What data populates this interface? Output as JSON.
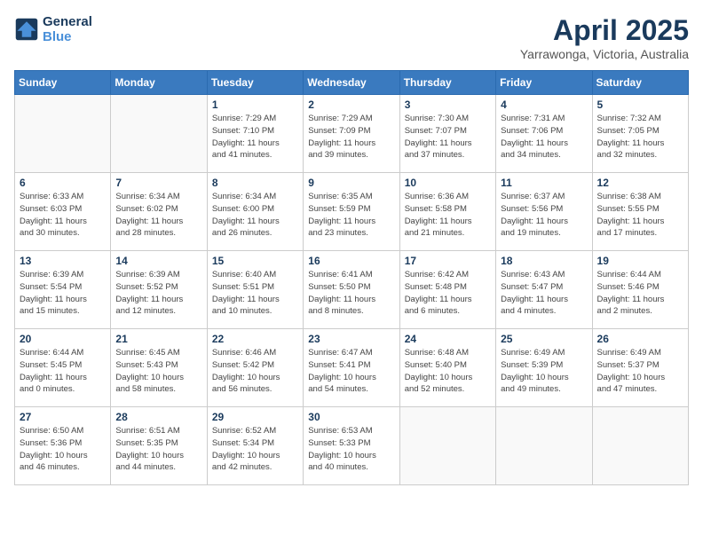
{
  "header": {
    "logo_line1": "General",
    "logo_line2": "Blue",
    "month_title": "April 2025",
    "location": "Yarrawonga, Victoria, Australia"
  },
  "weekdays": [
    "Sunday",
    "Monday",
    "Tuesday",
    "Wednesday",
    "Thursday",
    "Friday",
    "Saturday"
  ],
  "weeks": [
    [
      {
        "day": "",
        "info": ""
      },
      {
        "day": "",
        "info": ""
      },
      {
        "day": "1",
        "info": "Sunrise: 7:29 AM\nSunset: 7:10 PM\nDaylight: 11 hours\nand 41 minutes."
      },
      {
        "day": "2",
        "info": "Sunrise: 7:29 AM\nSunset: 7:09 PM\nDaylight: 11 hours\nand 39 minutes."
      },
      {
        "day": "3",
        "info": "Sunrise: 7:30 AM\nSunset: 7:07 PM\nDaylight: 11 hours\nand 37 minutes."
      },
      {
        "day": "4",
        "info": "Sunrise: 7:31 AM\nSunset: 7:06 PM\nDaylight: 11 hours\nand 34 minutes."
      },
      {
        "day": "5",
        "info": "Sunrise: 7:32 AM\nSunset: 7:05 PM\nDaylight: 11 hours\nand 32 minutes."
      }
    ],
    [
      {
        "day": "6",
        "info": "Sunrise: 6:33 AM\nSunset: 6:03 PM\nDaylight: 11 hours\nand 30 minutes."
      },
      {
        "day": "7",
        "info": "Sunrise: 6:34 AM\nSunset: 6:02 PM\nDaylight: 11 hours\nand 28 minutes."
      },
      {
        "day": "8",
        "info": "Sunrise: 6:34 AM\nSunset: 6:00 PM\nDaylight: 11 hours\nand 26 minutes."
      },
      {
        "day": "9",
        "info": "Sunrise: 6:35 AM\nSunset: 5:59 PM\nDaylight: 11 hours\nand 23 minutes."
      },
      {
        "day": "10",
        "info": "Sunrise: 6:36 AM\nSunset: 5:58 PM\nDaylight: 11 hours\nand 21 minutes."
      },
      {
        "day": "11",
        "info": "Sunrise: 6:37 AM\nSunset: 5:56 PM\nDaylight: 11 hours\nand 19 minutes."
      },
      {
        "day": "12",
        "info": "Sunrise: 6:38 AM\nSunset: 5:55 PM\nDaylight: 11 hours\nand 17 minutes."
      }
    ],
    [
      {
        "day": "13",
        "info": "Sunrise: 6:39 AM\nSunset: 5:54 PM\nDaylight: 11 hours\nand 15 minutes."
      },
      {
        "day": "14",
        "info": "Sunrise: 6:39 AM\nSunset: 5:52 PM\nDaylight: 11 hours\nand 12 minutes."
      },
      {
        "day": "15",
        "info": "Sunrise: 6:40 AM\nSunset: 5:51 PM\nDaylight: 11 hours\nand 10 minutes."
      },
      {
        "day": "16",
        "info": "Sunrise: 6:41 AM\nSunset: 5:50 PM\nDaylight: 11 hours\nand 8 minutes."
      },
      {
        "day": "17",
        "info": "Sunrise: 6:42 AM\nSunset: 5:48 PM\nDaylight: 11 hours\nand 6 minutes."
      },
      {
        "day": "18",
        "info": "Sunrise: 6:43 AM\nSunset: 5:47 PM\nDaylight: 11 hours\nand 4 minutes."
      },
      {
        "day": "19",
        "info": "Sunrise: 6:44 AM\nSunset: 5:46 PM\nDaylight: 11 hours\nand 2 minutes."
      }
    ],
    [
      {
        "day": "20",
        "info": "Sunrise: 6:44 AM\nSunset: 5:45 PM\nDaylight: 11 hours\nand 0 minutes."
      },
      {
        "day": "21",
        "info": "Sunrise: 6:45 AM\nSunset: 5:43 PM\nDaylight: 10 hours\nand 58 minutes."
      },
      {
        "day": "22",
        "info": "Sunrise: 6:46 AM\nSunset: 5:42 PM\nDaylight: 10 hours\nand 56 minutes."
      },
      {
        "day": "23",
        "info": "Sunrise: 6:47 AM\nSunset: 5:41 PM\nDaylight: 10 hours\nand 54 minutes."
      },
      {
        "day": "24",
        "info": "Sunrise: 6:48 AM\nSunset: 5:40 PM\nDaylight: 10 hours\nand 52 minutes."
      },
      {
        "day": "25",
        "info": "Sunrise: 6:49 AM\nSunset: 5:39 PM\nDaylight: 10 hours\nand 49 minutes."
      },
      {
        "day": "26",
        "info": "Sunrise: 6:49 AM\nSunset: 5:37 PM\nDaylight: 10 hours\nand 47 minutes."
      }
    ],
    [
      {
        "day": "27",
        "info": "Sunrise: 6:50 AM\nSunset: 5:36 PM\nDaylight: 10 hours\nand 46 minutes."
      },
      {
        "day": "28",
        "info": "Sunrise: 6:51 AM\nSunset: 5:35 PM\nDaylight: 10 hours\nand 44 minutes."
      },
      {
        "day": "29",
        "info": "Sunrise: 6:52 AM\nSunset: 5:34 PM\nDaylight: 10 hours\nand 42 minutes."
      },
      {
        "day": "30",
        "info": "Sunrise: 6:53 AM\nSunset: 5:33 PM\nDaylight: 10 hours\nand 40 minutes."
      },
      {
        "day": "",
        "info": ""
      },
      {
        "day": "",
        "info": ""
      },
      {
        "day": "",
        "info": ""
      }
    ]
  ]
}
